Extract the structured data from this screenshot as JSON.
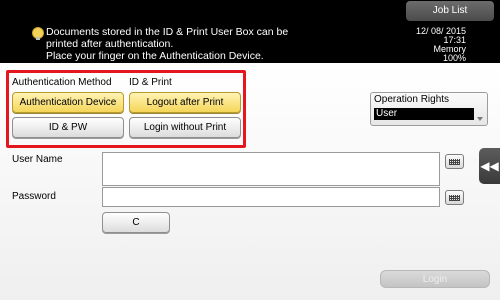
{
  "header": {
    "job_list_label": "Job List",
    "message_lines": [
      "Documents stored in the ID & Print User Box can be",
      "printed after authentication.",
      "Place your finger on the Authentication Device."
    ],
    "status": {
      "date": "12/ 08/ 2015",
      "time": "17:31",
      "memory_label": "Memory",
      "memory_value": "100%"
    }
  },
  "auth": {
    "method_label": "Authentication Method",
    "id_print_label": "ID & Print",
    "buttons": {
      "auth_device": "Authentication Device",
      "id_pw": "ID & PW",
      "logout_after_print": "Logout after Print",
      "login_without_print": "Login without Print"
    }
  },
  "operation_rights": {
    "label": "Operation Rights",
    "value": "User"
  },
  "form": {
    "user_name_label": "User Name",
    "password_label": "Password",
    "clear_button": "C",
    "login_button": "Login"
  },
  "colors": {
    "highlight": "#e4171f",
    "selected_button": "#f5d659"
  },
  "icons": {
    "bulb": "lightbulb-icon",
    "keyboard": "keyboard-icon",
    "side_arrow": "double-chevron-left-icon"
  }
}
